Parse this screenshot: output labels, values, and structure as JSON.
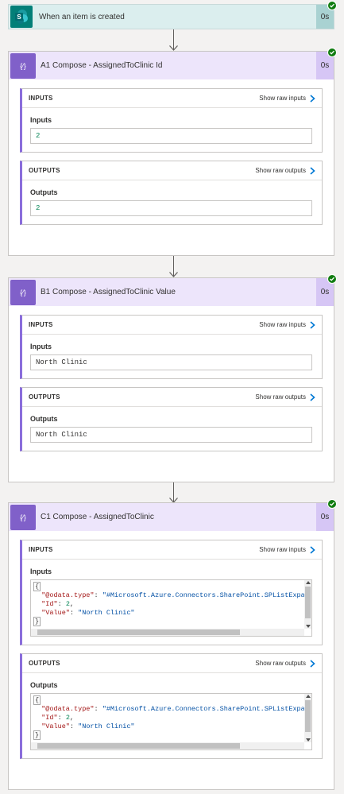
{
  "trigger": {
    "title": "When an item is created",
    "duration": "0s",
    "icon": "sharepoint-icon"
  },
  "steps": [
    {
      "title": "A1 Compose - AssignedToClinic Id",
      "duration": "0s",
      "inputs_header": "INPUTS",
      "show_raw_inputs": "Show raw inputs",
      "inputs_label": "Inputs",
      "inputs_value": "2",
      "outputs_header": "OUTPUTS",
      "show_raw_outputs": "Show raw outputs",
      "outputs_label": "Outputs",
      "outputs_value": "2"
    },
    {
      "title": "B1 Compose - AssignedToClinic Value",
      "duration": "0s",
      "inputs_header": "INPUTS",
      "show_raw_inputs": "Show raw inputs",
      "inputs_label": "Inputs",
      "inputs_value": "North Clinic",
      "outputs_header": "OUTPUTS",
      "show_raw_outputs": "Show raw outputs",
      "outputs_label": "Outputs",
      "outputs_value": "North Clinic"
    },
    {
      "title": "C1 Compose - AssignedToClinic",
      "duration": "0s",
      "inputs_header": "INPUTS",
      "show_raw_inputs": "Show raw inputs",
      "inputs_label": "Inputs",
      "outputs_header": "OUTPUTS",
      "show_raw_outputs": "Show raw outputs",
      "outputs_label": "Outputs",
      "json": {
        "open": "{",
        "close": "}",
        "k1": "\"@odata.type\"",
        "v1": "\"#Microsoft.Azure.Connectors.SharePoint.SPListExpa",
        "k2": "\"Id\"",
        "v2": "2",
        "k3": "\"Value\"",
        "v3": "\"North Clinic\""
      }
    }
  ],
  "colors": {
    "trigger": "#037f78",
    "compose": "#8060c9",
    "success": "#107c10",
    "accent": "#8a6ddb"
  }
}
